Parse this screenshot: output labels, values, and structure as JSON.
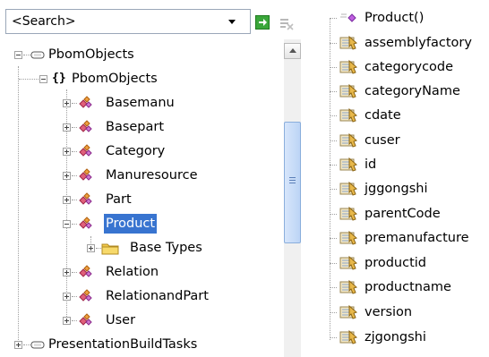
{
  "search": {
    "placeholder_text": "<Search>"
  },
  "tree": {
    "items": [
      {
        "label": "PbomObjects",
        "kind": "project",
        "toggle": "minus"
      },
      {
        "label": "PbomObjects",
        "kind": "namespace",
        "toggle": "minus"
      },
      {
        "label": "Basemanu",
        "kind": "class",
        "toggle": "plus"
      },
      {
        "label": "Basepart",
        "kind": "class",
        "toggle": "plus"
      },
      {
        "label": "Category",
        "kind": "class",
        "toggle": "plus"
      },
      {
        "label": "Manuresource",
        "kind": "class",
        "toggle": "plus"
      },
      {
        "label": "Part",
        "kind": "class",
        "toggle": "plus"
      },
      {
        "label": "Product",
        "kind": "class",
        "toggle": "minus",
        "selected": true
      },
      {
        "label": "Base Types",
        "kind": "folder",
        "toggle": "plus"
      },
      {
        "label": "Relation",
        "kind": "class",
        "toggle": "plus"
      },
      {
        "label": "RelationandPart",
        "kind": "class",
        "toggle": "plus"
      },
      {
        "label": "User",
        "kind": "class",
        "toggle": "plus"
      },
      {
        "label": "PresentationBuildTasks",
        "kind": "project",
        "toggle": "plus"
      }
    ]
  },
  "members": {
    "items": [
      {
        "label": "Product()",
        "kind": "method"
      },
      {
        "label": "assemblyfactory",
        "kind": "property"
      },
      {
        "label": "categorycode",
        "kind": "property"
      },
      {
        "label": "categoryName",
        "kind": "property"
      },
      {
        "label": "cdate",
        "kind": "property"
      },
      {
        "label": "cuser",
        "kind": "property"
      },
      {
        "label": "id",
        "kind": "property"
      },
      {
        "label": "jggongshi",
        "kind": "property"
      },
      {
        "label": "parentCode",
        "kind": "property"
      },
      {
        "label": "premanufacture",
        "kind": "property"
      },
      {
        "label": "productid",
        "kind": "property"
      },
      {
        "label": "productname",
        "kind": "property"
      },
      {
        "label": "version",
        "kind": "property"
      },
      {
        "label": "zjgongshi",
        "kind": "property"
      }
    ]
  },
  "colors": {
    "selection": "#3874d0",
    "class_icon": "#c8406a",
    "folder": "#f2c94c",
    "property": "#c9a14a",
    "method": "#b94fd6"
  }
}
